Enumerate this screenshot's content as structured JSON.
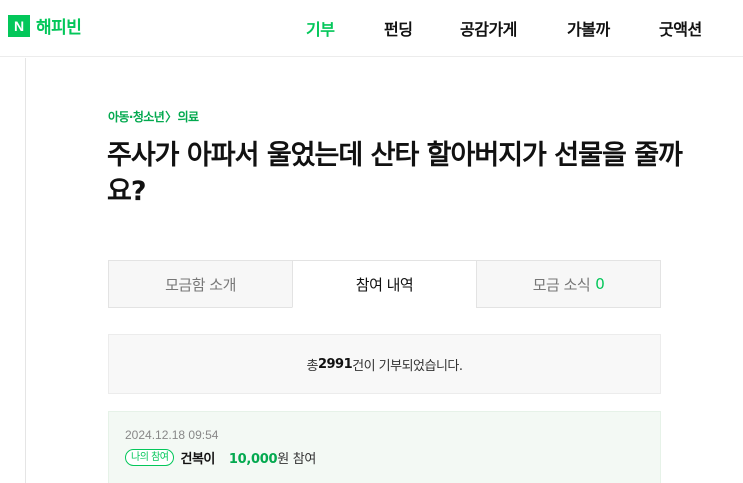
{
  "logo": {
    "mark": "N",
    "text": "해피빈"
  },
  "nav": {
    "items": [
      {
        "label": "기부",
        "active": true
      },
      {
        "label": "펀딩",
        "active": false
      },
      {
        "label": "공감가게",
        "active": false
      },
      {
        "label": "가볼까",
        "active": false
      },
      {
        "label": "굿액션",
        "active": false
      }
    ]
  },
  "breadcrumb": {
    "category": "아동·청소년",
    "separator": "〉",
    "subcategory": "의료"
  },
  "title": "주사가 아파서 울었는데 산타 할아버지가 선물을 줄까요?",
  "tabs": [
    {
      "label": "모금함 소개",
      "count": "",
      "active": false
    },
    {
      "label": "참여 내역",
      "count": "",
      "active": true
    },
    {
      "label": "모금 소식",
      "count": "0",
      "active": false
    }
  ],
  "summary": {
    "prefix": "총 ",
    "count": "2991",
    "suffix": "건이 기부되었습니다."
  },
  "donations": [
    {
      "date": "2024.12.18 09:54",
      "badge": "나의 참여",
      "donor": "건복이",
      "amount": "10,000",
      "amount_suffix": "원 참여"
    }
  ],
  "colors": {
    "brand_green": "#03c75a",
    "text_dark": "#111111",
    "tab_inactive_bg": "#f7f7f7",
    "item_bg": "#f3f9f4"
  }
}
